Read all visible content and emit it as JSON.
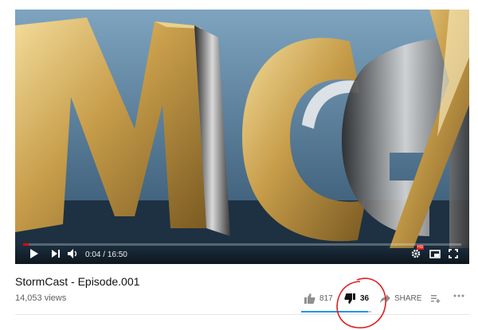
{
  "player": {
    "time_current": "0:04",
    "time_separator": " / ",
    "time_total": "16:50",
    "progress_fraction": 0.004,
    "icons": [
      "play-icon",
      "next-icon",
      "volume-icon",
      "settings-hd-icon",
      "miniplayer-icon",
      "fullscreen-icon"
    ],
    "hd_badge": "HD"
  },
  "video": {
    "title": "StormCast - Episode.001",
    "views": "14,053 views"
  },
  "actions": {
    "like_count": "817",
    "dislike_count": "36",
    "share_label": "SHARE",
    "like_ratio": 0.958
  },
  "colors": {
    "progress": "#ff0000",
    "like_bar": "#2793e6",
    "annotation": "#e02020"
  }
}
